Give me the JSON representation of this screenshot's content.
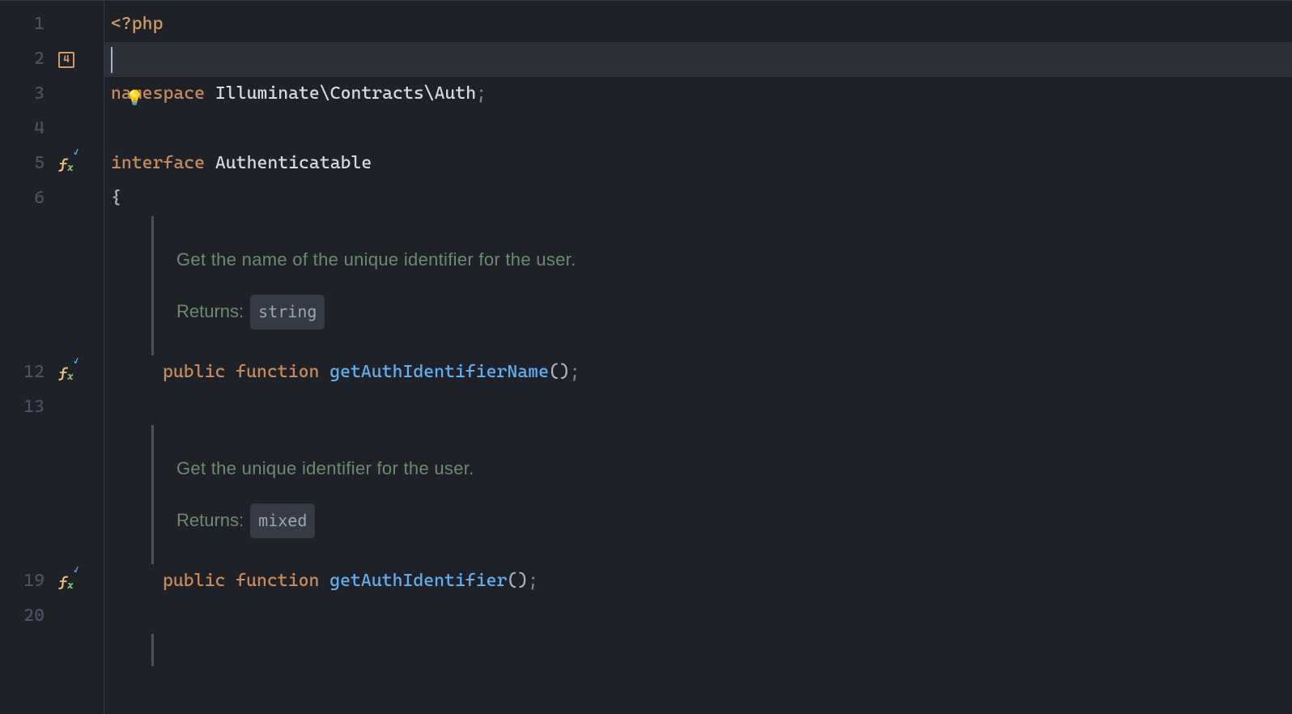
{
  "lines": {
    "l1": {
      "num": "1"
    },
    "l2": {
      "num": "2",
      "badge": "4"
    },
    "l3": {
      "num": "3"
    },
    "l4": {
      "num": "4"
    },
    "l5": {
      "num": "5"
    },
    "l6": {
      "num": "6"
    },
    "l12": {
      "num": "12"
    },
    "l13": {
      "num": "13"
    },
    "l19": {
      "num": "19"
    },
    "l20": {
      "num": "20"
    }
  },
  "code": {
    "php_open": "<?php",
    "namespace_kw": "namespace",
    "namespace_val": "Illuminate\\Contracts\\Auth",
    "semi": ";",
    "interface_kw": "interface",
    "interface_name": "Authenticatable",
    "brace_open": "{",
    "public_kw": "public",
    "function_kw": "function",
    "method1": "getAuthIdentifierName",
    "method2": "getAuthIdentifier",
    "parens": "()",
    "space": " "
  },
  "docs": {
    "d1_text": "Get the name of the unique identifier for the user.",
    "d1_returns_label": "Returns:",
    "d1_returns_type": "string",
    "d2_text": "Get the unique identifier for the user.",
    "d2_returns_label": "Returns:",
    "d2_returns_type": "mixed"
  },
  "icons": {
    "fx": "f",
    "fx_sub": "x",
    "lightbulb": "💡"
  }
}
